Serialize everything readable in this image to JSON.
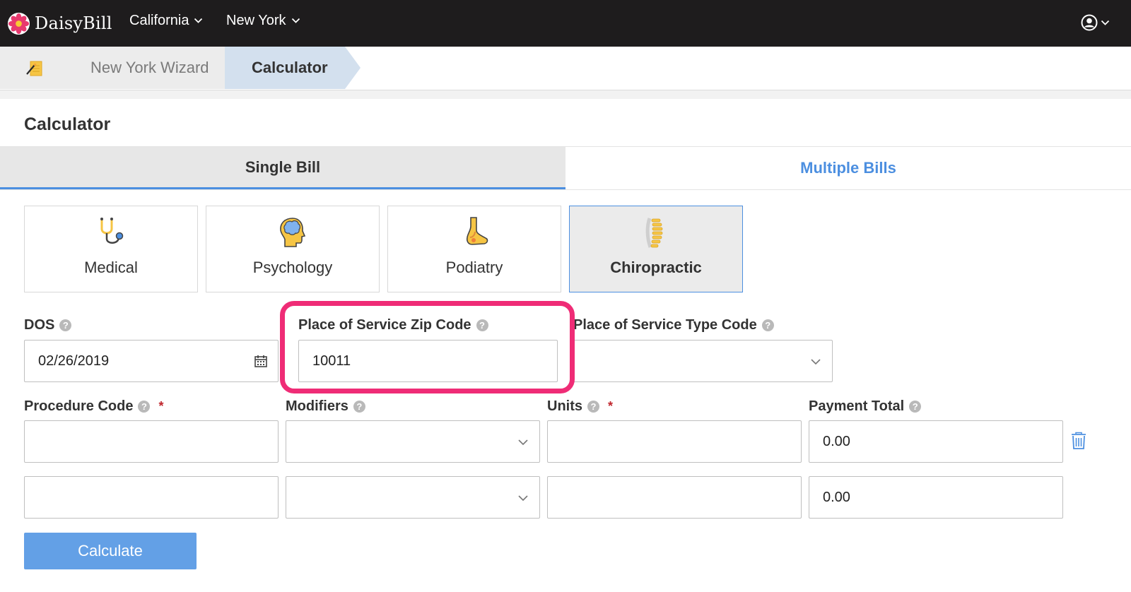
{
  "navbar": {
    "brand": "DaisyBill",
    "states": [
      {
        "label": "California"
      },
      {
        "label": "New York"
      }
    ]
  },
  "breadcrumb": {
    "items": [
      {
        "label": "New York Wizard"
      },
      {
        "label": "Calculator"
      }
    ]
  },
  "page": {
    "title": "Calculator"
  },
  "tabs": [
    {
      "label": "Single Bill",
      "active": true
    },
    {
      "label": "Multiple Bills",
      "active": false
    }
  ],
  "specialties": [
    {
      "label": "Medical",
      "icon": "stethoscope-icon",
      "selected": false
    },
    {
      "label": "Psychology",
      "icon": "brain-head-icon",
      "selected": false
    },
    {
      "label": "Podiatry",
      "icon": "foot-icon",
      "selected": false
    },
    {
      "label": "Chiropractic",
      "icon": "spine-icon",
      "selected": true
    }
  ],
  "form": {
    "dos": {
      "label": "DOS",
      "value": "02/26/2019"
    },
    "zip": {
      "label": "Place of Service Zip Code",
      "value": "10011"
    },
    "pos_type": {
      "label": "Place of Service Type Code",
      "value": ""
    },
    "procedure": {
      "label": "Procedure Code",
      "required_mark": "*"
    },
    "modifiers": {
      "label": "Modifiers"
    },
    "units": {
      "label": "Units",
      "required_mark": "*"
    },
    "payment": {
      "label": "Payment Total"
    },
    "rows": [
      {
        "procedure": "",
        "modifier": "",
        "units": "",
        "payment": "0.00"
      },
      {
        "procedure": "",
        "modifier": "",
        "units": "",
        "payment": "0.00"
      }
    ],
    "calculate_label": "Calculate"
  },
  "colors": {
    "accent": "#4c8fe0",
    "button": "#63a0e6",
    "highlight": "#ef2c76",
    "navbar": "#1e1c1d",
    "required": "#c0262d"
  }
}
